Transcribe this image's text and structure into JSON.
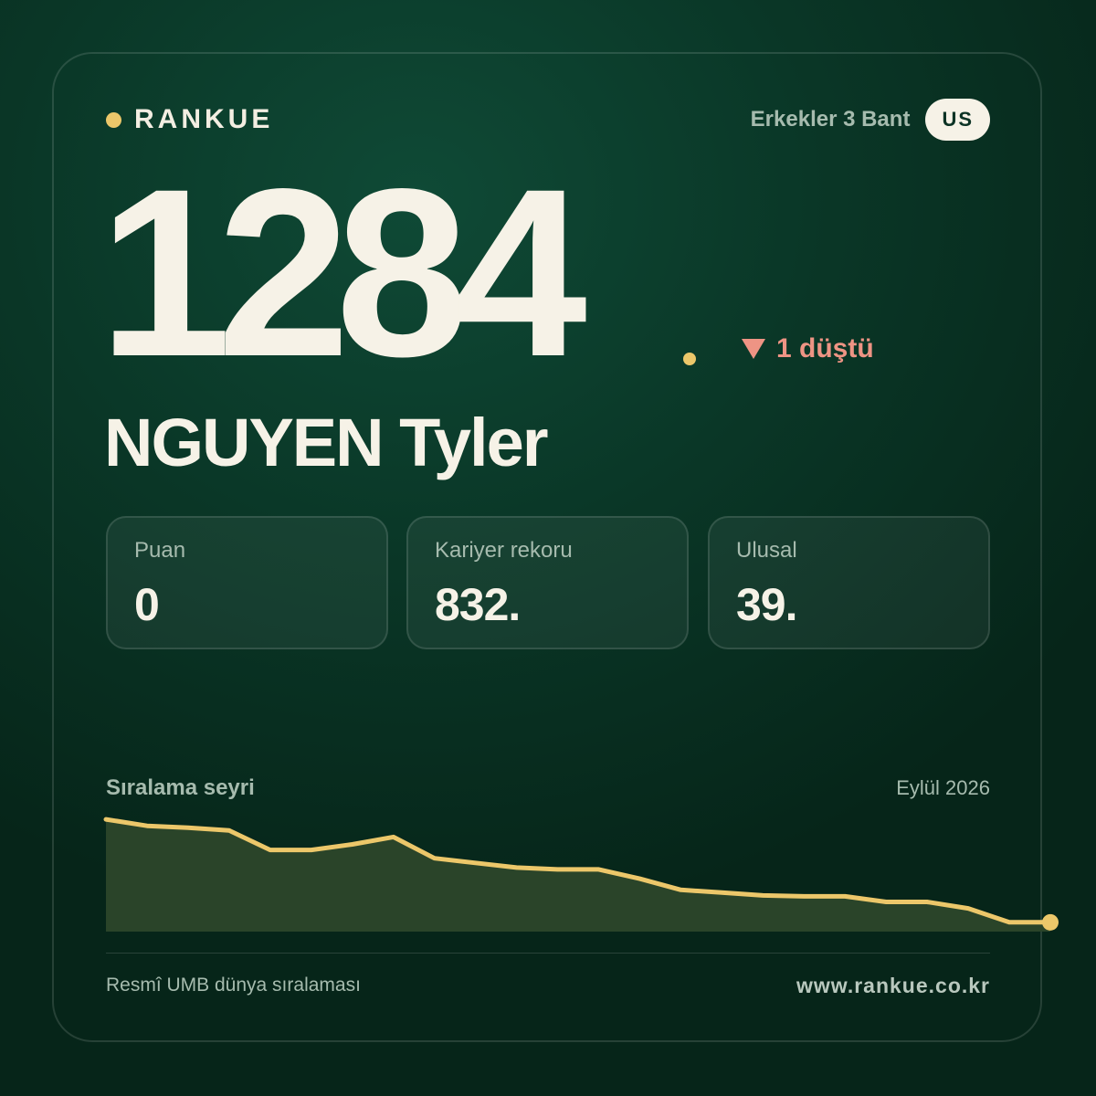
{
  "brand": {
    "name": "RANKUE",
    "dot_color": "#ecc76a"
  },
  "header": {
    "category": "Erkekler 3 Bant",
    "country": "US"
  },
  "rank": {
    "current": "1284",
    "change_text": "1 düştü",
    "change_direction": "down",
    "change_color": "#ee9484"
  },
  "player": {
    "name": "NGUYEN Tyler"
  },
  "stats": [
    {
      "label": "Puan",
      "value": "0"
    },
    {
      "label": "Kariyer rekoru",
      "value": "832."
    },
    {
      "label": "Ulusal",
      "value": "39."
    }
  ],
  "trend": {
    "title": "Sıralama seyri",
    "date": "Eylül 2026",
    "line_color": "#ecc76a",
    "fill_color": "#2a4429"
  },
  "chart_data": {
    "type": "area",
    "x": [
      1,
      2,
      3,
      4,
      5,
      6,
      7,
      8,
      9,
      10,
      11,
      12,
      13,
      14,
      15,
      16,
      17,
      18,
      19,
      20,
      21,
      22,
      23,
      24
    ],
    "y": [
      4,
      11,
      13,
      16,
      37,
      37,
      31,
      23,
      46,
      51,
      56,
      58,
      58,
      68,
      80,
      83,
      86,
      87,
      87,
      93,
      93,
      100,
      115,
      115
    ],
    "ylim": [
      0,
      125
    ],
    "y_inverted": true,
    "last_point_marker": true,
    "title": "",
    "xlabel": "",
    "ylabel": ""
  },
  "footer": {
    "source": "Resmî UMB dünya sıralaması",
    "website": "www.rankue.co.kr"
  }
}
